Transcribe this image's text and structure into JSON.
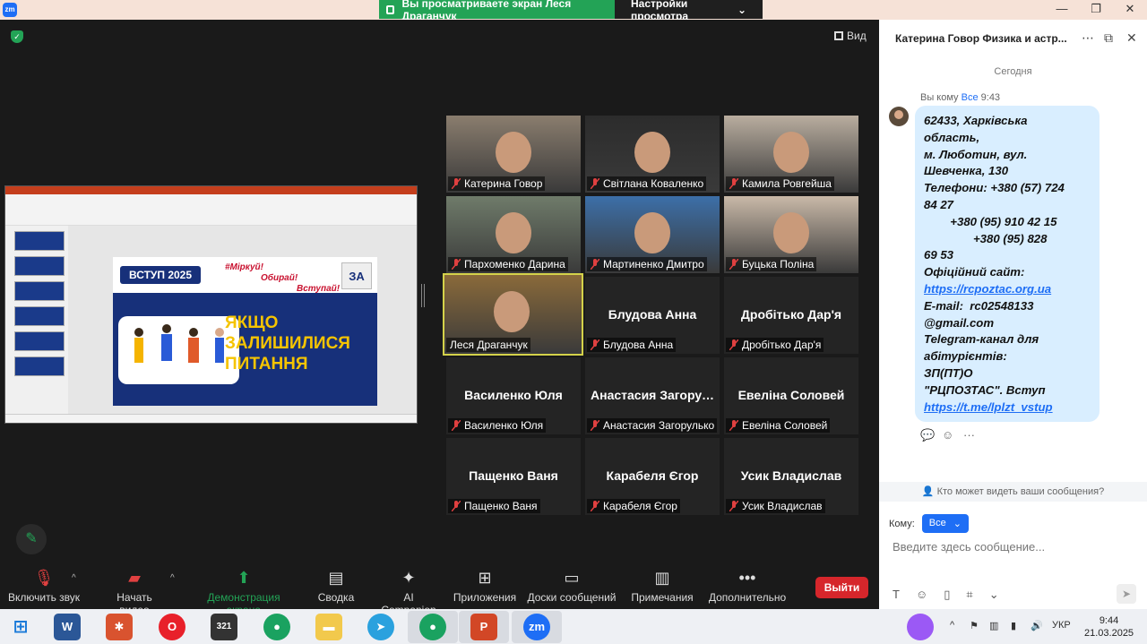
{
  "titlebar": {
    "share_text": "Вы просматриваете экран Леся Драганчук",
    "view_settings": "Настройки просмотра",
    "win_min": "—",
    "win_max": "❐",
    "win_close": "✕"
  },
  "stage": {
    "view_label": "Вид"
  },
  "slide": {
    "vstup": "ВСТУП 2025",
    "mirkuy": "#Міркуй!",
    "obyray": "Обирай!",
    "vstupay": "Вступай!",
    "logo": "ЗА",
    "line1": "ЯКЩО",
    "line2": "ЗАЛИШИЛИСЯ",
    "line3": "ПИТАННЯ"
  },
  "participants": [
    {
      "label": "Катерина Говор",
      "big": "",
      "video": true,
      "color": "#8a7d6e"
    },
    {
      "label": "Світлана Коваленко",
      "big": "",
      "video": true,
      "color": "#2c2c2c"
    },
    {
      "label": "Камила Ровгейша",
      "big": "",
      "video": true,
      "color": "#b9ad9f"
    },
    {
      "label": "Пархоменко Дарина",
      "big": "",
      "video": true,
      "color": "#6f7b6a"
    },
    {
      "label": "Мартиненко Дмитро",
      "big": "",
      "video": true,
      "color": "#3c6fa8"
    },
    {
      "label": "Буцька Поліна",
      "big": "",
      "video": true,
      "color": "#c9b9a8"
    },
    {
      "label": "Леся Драганчук",
      "big": "",
      "video": true,
      "color": "#8a6a3a"
    },
    {
      "label": "Блудова Анна",
      "big": "Блудова Анна",
      "video": false
    },
    {
      "label": "Дробітько Дар'я",
      "big": "Дробітько Дар'я",
      "video": false
    },
    {
      "label": "Василенко Юля",
      "big": "Василенко Юля",
      "video": false
    },
    {
      "label": "Анастасия Загорулько",
      "big": "Анастасия Загорулько",
      "video": false
    },
    {
      "label": "Евеліна Соловей",
      "big": "Евеліна Соловей",
      "video": false
    },
    {
      "label": "Пащенко  Ваня",
      "big": "Пащенко  Ваня",
      "video": false
    },
    {
      "label": "Карабеля Єгор",
      "big": "Карабеля Єгор",
      "video": false
    },
    {
      "label": "Усик Владислав",
      "big": "Усик Владислав",
      "video": false
    }
  ],
  "toolbar": {
    "mute": "Включить звук",
    "video": "Начать видео",
    "share": "Демонстрация экрана",
    "summary": "Сводка",
    "ai": "AI Companion",
    "apps": "Приложения",
    "boards": "Доски сообщений",
    "notes": "Примечания",
    "more": "Дополнительно",
    "leave": "Выйти"
  },
  "chat": {
    "title": "Катерина Говор Физика и астр...",
    "today": "Сегодня",
    "meta_prefix": "Вы кому",
    "meta_to": "Все",
    "meta_time": "9:43",
    "lines": [
      "62433, Харківська",
      "область,",
      "м. Люботин, вул.",
      "Шевченка, 130",
      "Телефони: +380 (57) 724",
      "84 27",
      "        +380 (95) 910 42 15",
      "               +380 (95) 828",
      "69 53",
      "Офіційний сайт:",
      "https://rcpoztac.org.ua",
      "E-mail:  rc02548133",
      "@gmail.com",
      "Telegram-канал для",
      "абітурієнтів:",
      "ЗП(ПТ)О",
      "\"РЦПОЗТАС\". Вступ",
      "https://t.me/lplzt_vstup"
    ],
    "link_lines": [
      10,
      17
    ],
    "who_can_see": "Кто может видеть ваши сообщения?",
    "to_label": "Кому:",
    "to_value": "Все",
    "placeholder": "Введите здесь сообщение..."
  },
  "taskbar": {
    "lang": "УКР",
    "time": "9:44",
    "date": "21.03.2025"
  }
}
